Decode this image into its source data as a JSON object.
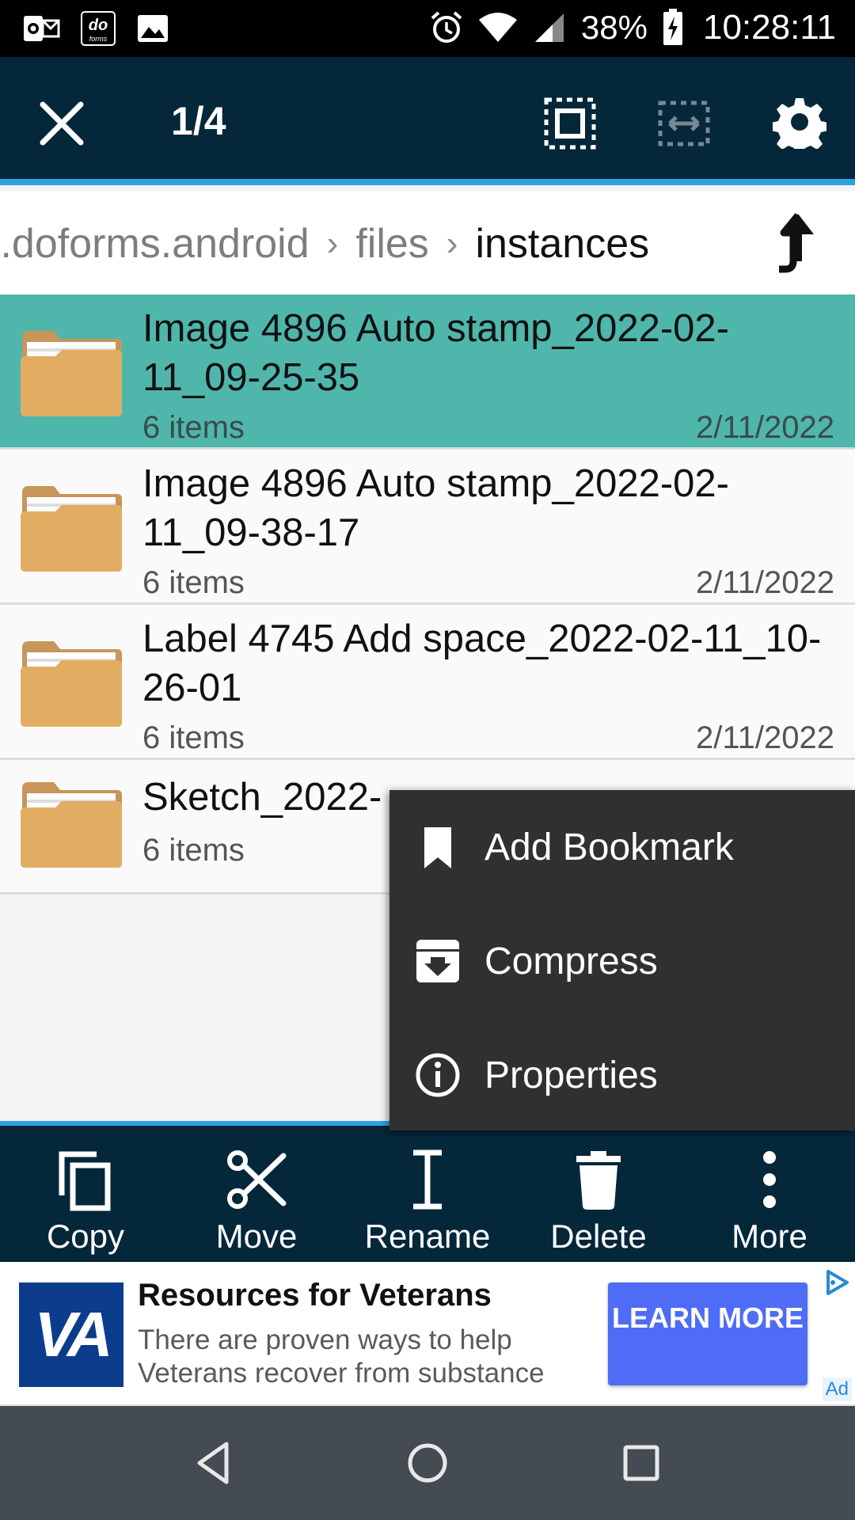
{
  "status_bar": {
    "battery": "38%",
    "time": "10:28:11"
  },
  "toolbar": {
    "selection_count": "1/4"
  },
  "breadcrumb": {
    "segments": [
      "t.doforms.android",
      "files",
      "instances"
    ]
  },
  "files": [
    {
      "name": "Image 4896 Auto stamp_2022-02-11_09-25-35",
      "meta": "6 items",
      "date": "2/11/2022",
      "selected": true
    },
    {
      "name": "Image 4896 Auto stamp_2022-02-11_09-38-17",
      "meta": "6 items",
      "date": "2/11/2022",
      "selected": false
    },
    {
      "name": "Label 4745 Add space_2022-02-11_10-26-01",
      "meta": "6 items",
      "date": "2/11/2022",
      "selected": false
    },
    {
      "name": "Sketch_2022-",
      "meta": "6 items",
      "date": "",
      "selected": false
    }
  ],
  "context_menu": {
    "items": [
      {
        "label": "Add Bookmark",
        "icon": "bookmark-icon"
      },
      {
        "label": "Compress",
        "icon": "archive-icon"
      },
      {
        "label": "Properties",
        "icon": "info-icon"
      }
    ]
  },
  "actions": [
    {
      "label": "Copy",
      "icon": "copy-icon"
    },
    {
      "label": "Move",
      "icon": "scissors-icon"
    },
    {
      "label": "Rename",
      "icon": "text-cursor-icon"
    },
    {
      "label": "Delete",
      "icon": "trash-icon"
    },
    {
      "label": "More",
      "icon": "more-vertical-icon"
    }
  ],
  "ad": {
    "logo_text": "VA",
    "title": "Resources for Veterans",
    "description": "There are proven ways to help Veterans recover from substance",
    "cta": "LEARN MORE",
    "tag": "Ad",
    "colors": {
      "cta": "#4e6cf6",
      "logo": "#0c3c8c"
    }
  },
  "colors": {
    "toolbar": "#04273a",
    "accent": "#2fa3e0",
    "selected_row": "#4fb6ac",
    "menu_bg": "#303030",
    "folder": "#e2ad63"
  }
}
